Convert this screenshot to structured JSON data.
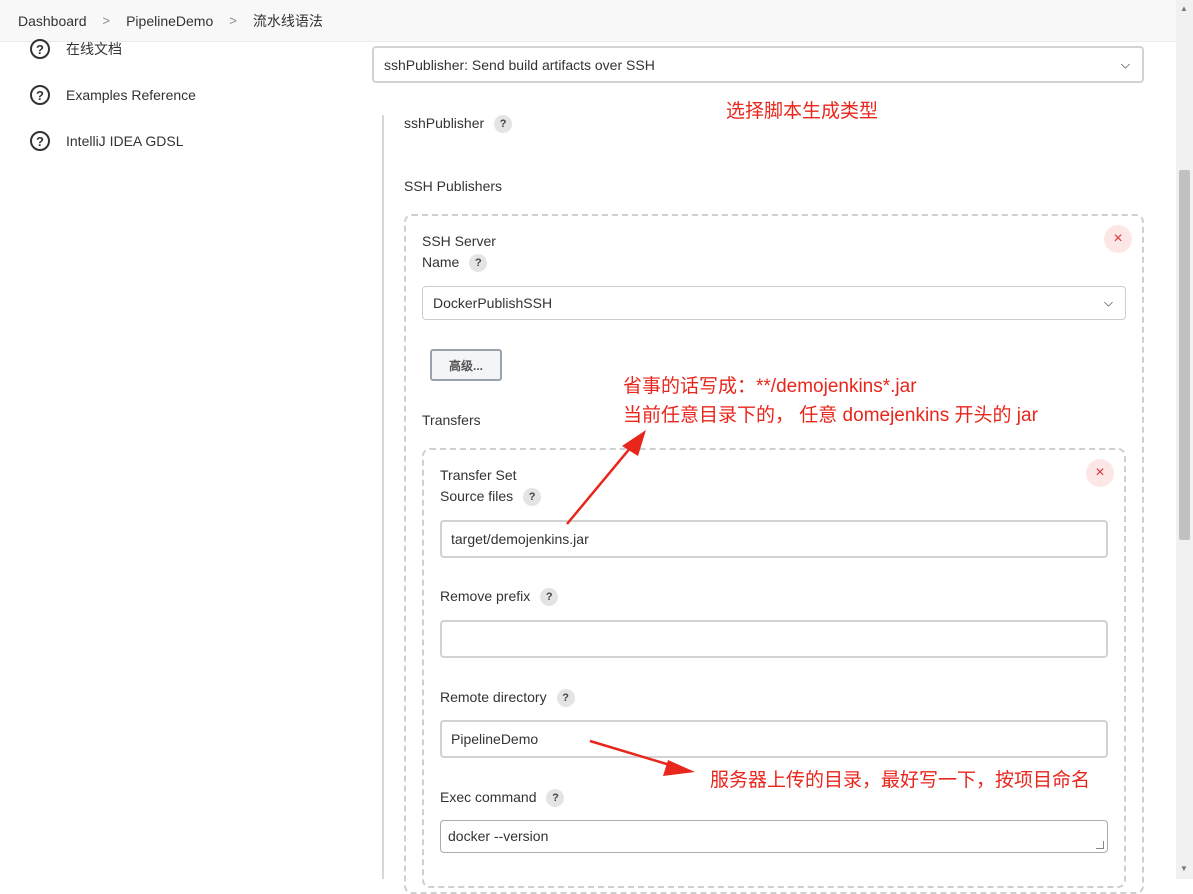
{
  "breadcrumb": [
    "Dashboard",
    "PipelineDemo",
    "流水线语法"
  ],
  "sidebar": {
    "items": [
      {
        "label": "在线文档"
      },
      {
        "label": "Examples Reference"
      },
      {
        "label": "IntelliJ IDEA GDSL"
      }
    ]
  },
  "sample_step": {
    "value": "sshPublisher: Send build artifacts over SSH"
  },
  "form": {
    "section_title": "sshPublisher",
    "ssh_publishers_label": "SSH Publishers",
    "server_label": "SSH Server",
    "name_label": "Name",
    "name_value": "DockerPublishSSH",
    "advanced_label": "高级...",
    "transfers_label": "Transfers",
    "transfer_set_label": "Transfer Set",
    "source_files_label": "Source files",
    "source_files_value": "target/demojenkins.jar",
    "remove_prefix_label": "Remove prefix",
    "remove_prefix_value": "",
    "remote_directory_label": "Remote directory",
    "remote_directory_value": "PipelineDemo",
    "exec_command_label": "Exec command",
    "exec_command_value": "docker --version",
    "help_glyph": "?",
    "close_glyph": "×"
  },
  "annotations": {
    "choose_type": "选择脚本生成类型",
    "source_hint_1": "省事的话写成：**/demojenkins*.jar",
    "source_hint_2": "当前任意目录下的， 任意 domejenkins 开头的 jar",
    "remote_dir_hint": "服务器上传的目录，最好写一下，按项目命名"
  },
  "colors": {
    "annotation": "#e8261c",
    "close_bg": "#fde6e6",
    "close_fg": "#d33"
  }
}
